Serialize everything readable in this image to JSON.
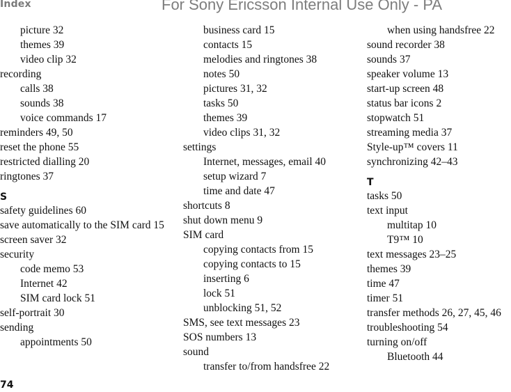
{
  "header": {
    "title": "Index",
    "watermark": "For Sony Ericsson Internal Use Only - PA"
  },
  "footer": {
    "page_number": "74"
  },
  "columns": [
    {
      "items": [
        {
          "type": "sub",
          "text": "picture 32"
        },
        {
          "type": "sub",
          "text": "themes 39"
        },
        {
          "type": "sub",
          "text": "video clip 32"
        },
        {
          "type": "main",
          "text": "recording"
        },
        {
          "type": "sub",
          "text": "calls 38"
        },
        {
          "type": "sub",
          "text": "sounds 38"
        },
        {
          "type": "sub",
          "text": "voice commands 17"
        },
        {
          "type": "main",
          "text": "reminders 49, 50"
        },
        {
          "type": "main",
          "text": "reset the phone 55"
        },
        {
          "type": "main",
          "text": "restricted dialling 20"
        },
        {
          "type": "main",
          "text": "ringtones 37"
        },
        {
          "type": "letter",
          "text": "S"
        },
        {
          "type": "main",
          "text": "safety guidelines 60"
        },
        {
          "type": "wrap",
          "text": "save automatically to the SIM card 15"
        },
        {
          "type": "main",
          "text": "screen saver 32"
        },
        {
          "type": "main",
          "text": "security"
        },
        {
          "type": "sub",
          "text": "code memo 53"
        },
        {
          "type": "sub",
          "text": "Internet 42"
        },
        {
          "type": "sub",
          "text": "SIM card lock 51"
        },
        {
          "type": "main",
          "text": "self-portrait 30"
        },
        {
          "type": "main",
          "text": "sending"
        },
        {
          "type": "sub",
          "text": "appointments 50"
        }
      ]
    },
    {
      "items": [
        {
          "type": "sub",
          "text": "business card 15"
        },
        {
          "type": "sub",
          "text": "contacts 15"
        },
        {
          "type": "sub",
          "text": "melodies and ringtones 38"
        },
        {
          "type": "sub",
          "text": "notes 50"
        },
        {
          "type": "sub",
          "text": "pictures 31, 32"
        },
        {
          "type": "sub",
          "text": "tasks 50"
        },
        {
          "type": "sub",
          "text": "themes 39"
        },
        {
          "type": "sub",
          "text": "video clips 31, 32"
        },
        {
          "type": "main",
          "text": "settings"
        },
        {
          "type": "sub",
          "text": "Internet, messages, email 40"
        },
        {
          "type": "sub",
          "text": "setup wizard 7"
        },
        {
          "type": "sub",
          "text": "time and date 47"
        },
        {
          "type": "main",
          "text": "shortcuts 8"
        },
        {
          "type": "main",
          "text": "shut down menu 9"
        },
        {
          "type": "main",
          "text": "SIM card"
        },
        {
          "type": "sub",
          "text": "copying contacts from 15"
        },
        {
          "type": "sub",
          "text": "copying contacts to 15"
        },
        {
          "type": "sub",
          "text": "inserting 6"
        },
        {
          "type": "sub",
          "text": "lock 51"
        },
        {
          "type": "sub",
          "text": "unblocking 51, 52"
        },
        {
          "type": "main",
          "text": "SMS, see text messages 23"
        },
        {
          "type": "main",
          "text": "SOS numbers 13"
        },
        {
          "type": "main",
          "text": "sound"
        },
        {
          "type": "sub",
          "text": "transfer to/from handsfree 22"
        }
      ]
    },
    {
      "items": [
        {
          "type": "sub",
          "text": "when using handsfree 22"
        },
        {
          "type": "main",
          "text": "sound recorder 38"
        },
        {
          "type": "main",
          "text": "sounds 37"
        },
        {
          "type": "main",
          "text": "speaker volume 13"
        },
        {
          "type": "main",
          "text": "start-up screen 48"
        },
        {
          "type": "main",
          "text": "status bar icons 2"
        },
        {
          "type": "main",
          "text": "stopwatch 51"
        },
        {
          "type": "main",
          "text": "streaming media 37"
        },
        {
          "type": "main",
          "text": "Style-up™ covers 11"
        },
        {
          "type": "main",
          "text": "synchronizing 42–43"
        },
        {
          "type": "letter",
          "text": "T"
        },
        {
          "type": "main",
          "text": "tasks 50"
        },
        {
          "type": "main",
          "text": "text input"
        },
        {
          "type": "sub",
          "text": "multitap 10"
        },
        {
          "type": "sub",
          "text": "T9™ 10"
        },
        {
          "type": "main",
          "text": "text messages 23–25"
        },
        {
          "type": "main",
          "text": "themes 39"
        },
        {
          "type": "main",
          "text": "time 47"
        },
        {
          "type": "main",
          "text": "timer 51"
        },
        {
          "type": "main",
          "text": "transfer methods 26, 27, 45, 46"
        },
        {
          "type": "main",
          "text": "troubleshooting 54"
        },
        {
          "type": "main",
          "text": "turning on/off"
        },
        {
          "type": "sub",
          "text": "Bluetooth 44"
        }
      ]
    }
  ]
}
